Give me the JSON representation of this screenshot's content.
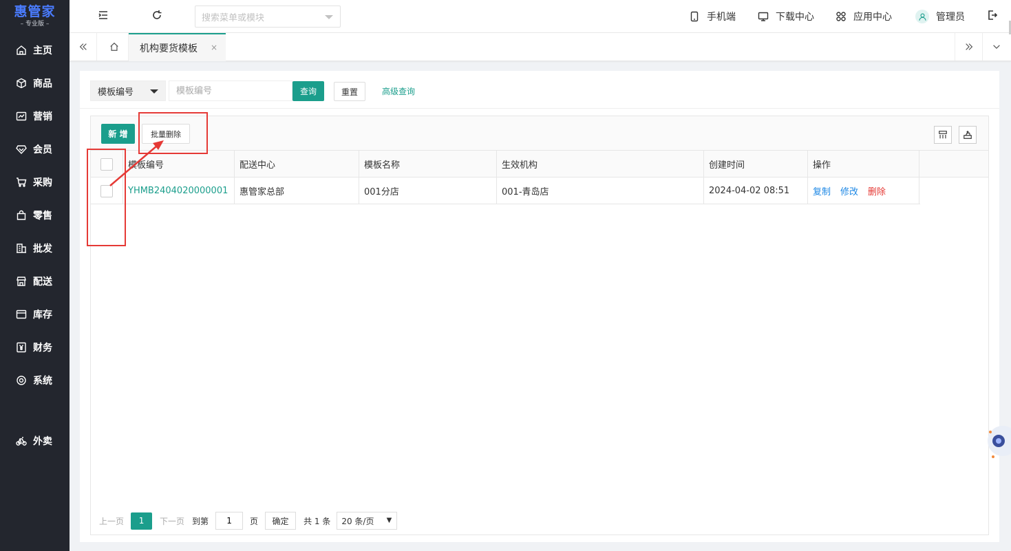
{
  "sidebar": {
    "logo_main": "惠管家",
    "logo_sub": "– 专业版 –",
    "items": [
      {
        "label": "主页",
        "icon": "home-icon"
      },
      {
        "label": "商品",
        "icon": "cube-icon"
      },
      {
        "label": "营销",
        "icon": "trend-icon"
      },
      {
        "label": "会员",
        "icon": "diamond-icon"
      },
      {
        "label": "采购",
        "icon": "cart-icon"
      },
      {
        "label": "零售",
        "icon": "bag-icon"
      },
      {
        "label": "批发",
        "icon": "building-icon"
      },
      {
        "label": "配送",
        "icon": "store-icon"
      },
      {
        "label": "库存",
        "icon": "box-icon"
      },
      {
        "label": "财务",
        "icon": "yen-icon"
      },
      {
        "label": "系统",
        "icon": "settings-icon"
      },
      {
        "label": "外卖",
        "icon": "bike-icon"
      }
    ]
  },
  "topbar": {
    "search_placeholder": "搜索菜单或模块",
    "mobile": "手机端",
    "download": "下载中心",
    "apps": "应用中心",
    "user": "管理员"
  },
  "tabs": {
    "active_label": "机构要货模板",
    "close": "×"
  },
  "filter": {
    "field_select": "模板编号",
    "input_placeholder": "模板编号",
    "query": "查询",
    "reset": "重置",
    "advanced": "高级查询"
  },
  "toolbar": {
    "add": "新 增",
    "batch_delete": "批量删除"
  },
  "table": {
    "headers": [
      "模板编号",
      "配送中心",
      "模板名称",
      "生效机构",
      "创建时间",
      "操作"
    ],
    "rows": [
      {
        "code": "YHMB2404020000001",
        "center": "惠管家总部",
        "name": "001分店",
        "org": "001-青岛店",
        "created": "2024-04-02 08:51",
        "ops": [
          "复制",
          "修改",
          "删除"
        ]
      }
    ]
  },
  "pager": {
    "prev": "上一页",
    "current": "1",
    "next": "下一页",
    "goto": "到第",
    "goto_value": "1",
    "page_unit": "页",
    "confirm": "确定",
    "total": "共 1 条",
    "per_page": "20 条/页"
  },
  "colors": {
    "accent": "#1b9e8c",
    "sidebar": "#23262e",
    "annotation": "#e53935",
    "link_blue": "#1e88e5"
  }
}
